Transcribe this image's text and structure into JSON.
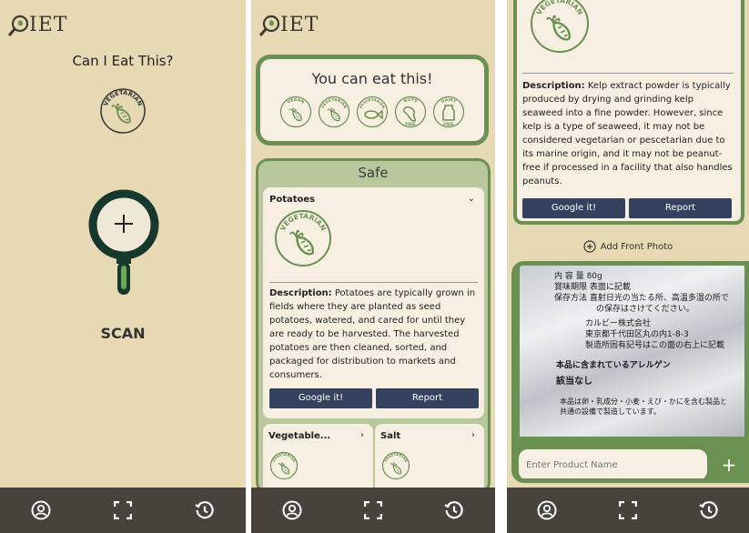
{
  "app": {
    "logo": "IET"
  },
  "screen1": {
    "title": "Can I Eat This?",
    "badge": "VEGETARIAN",
    "scan_label": "SCAN"
  },
  "screen2": {
    "result_title": "You can eat this!",
    "diet_badges": [
      {
        "top": "VEGAN",
        "bottom": ""
      },
      {
        "top": "VEGETARIAN",
        "bottom": ""
      },
      {
        "top": "PESCETARIAN",
        "bottom": ""
      },
      {
        "top": "NUTS",
        "bottom": "FREE"
      },
      {
        "top": "DAIRY",
        "bottom": "FREE"
      }
    ],
    "safe_title": "Safe",
    "item": {
      "name": "Potatoes",
      "badge": "VEGETARIAN",
      "desc_label": "Description:",
      "desc_text": "Potatoes are typically grown in fields where they are planted as seed potatoes, watered, and cared for until they are ready to be harvested. The harvested potatoes are then cleaned, sorted, and packaged for distribution to markets and consumers.",
      "google_label": "Google it!",
      "report_label": "Report"
    },
    "small_items": [
      {
        "name": "Vegetable...",
        "badge": "VEGETARIAN"
      },
      {
        "name": "Salt",
        "badge": "VEGETARIAN"
      }
    ]
  },
  "screen3": {
    "badge": "VEGETARIAN",
    "desc_label": "Description:",
    "desc_text": "Kelp extract powder is typically produced by drying and grinding kelp seaweed into a fine powder. However, since kelp is a type of seaweed, it may not be considered vegetarian or pescetarian due to its marine origin, and it may not be peanut-free if processed in a facility that also handles peanuts.",
    "google_label": "Google it!",
    "report_label": "Report",
    "add_photo_label": "Add Front Photo",
    "input_placeholder": "Enter Product Name",
    "photo_text": [
      "内 容 量  80g",
      "賞味期限  表面に記載",
      "保存方法  直射日光の当たる所、高温多湿の所で",
      "の保存はさけてください。",
      "カルビー株式会社",
      "東京都千代田区丸の内1-8-3",
      "製造所固有記号はこの面の右上に記載",
      "本品に含まれているアレルゲン",
      "該当なし",
      "本品は卵・乳成分・小麦・えび・かにを含む製品と",
      "共通の設備で製造しています。"
    ]
  },
  "colors": {
    "background": "#e6d9b4",
    "accent": "#6a9152",
    "nav": "#47423b",
    "button": "#344260",
    "card": "#f7efe1"
  },
  "icons": [
    "magnifier-leaf-logo",
    "account-icon",
    "scan-frame-icon",
    "history-icon",
    "carrot-icon",
    "fish-icon",
    "peanut-icon",
    "milk-carton-icon",
    "plus-icon"
  ]
}
